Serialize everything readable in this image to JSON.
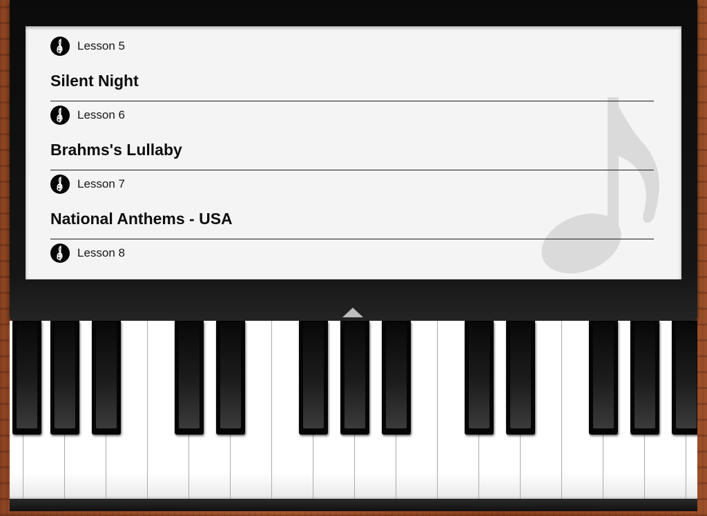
{
  "lessons": [
    {
      "label": "Lesson 5",
      "title": "Silent Night"
    },
    {
      "label": "Lesson 6",
      "title": "Brahms's Lullaby"
    },
    {
      "label": "Lesson 7",
      "title": "National Anthems - USA"
    },
    {
      "label": "Lesson 8",
      "title": ""
    }
  ],
  "icons": {
    "lesson": "treble-clef-icon",
    "watermark": "music-note-icon",
    "handle": "chevron-up-icon"
  },
  "colors": {
    "panel": "#f4f4f4",
    "frame": "#111111",
    "wood": "#8b4322",
    "black_key": "#050505",
    "white_key": "#ffffff"
  }
}
